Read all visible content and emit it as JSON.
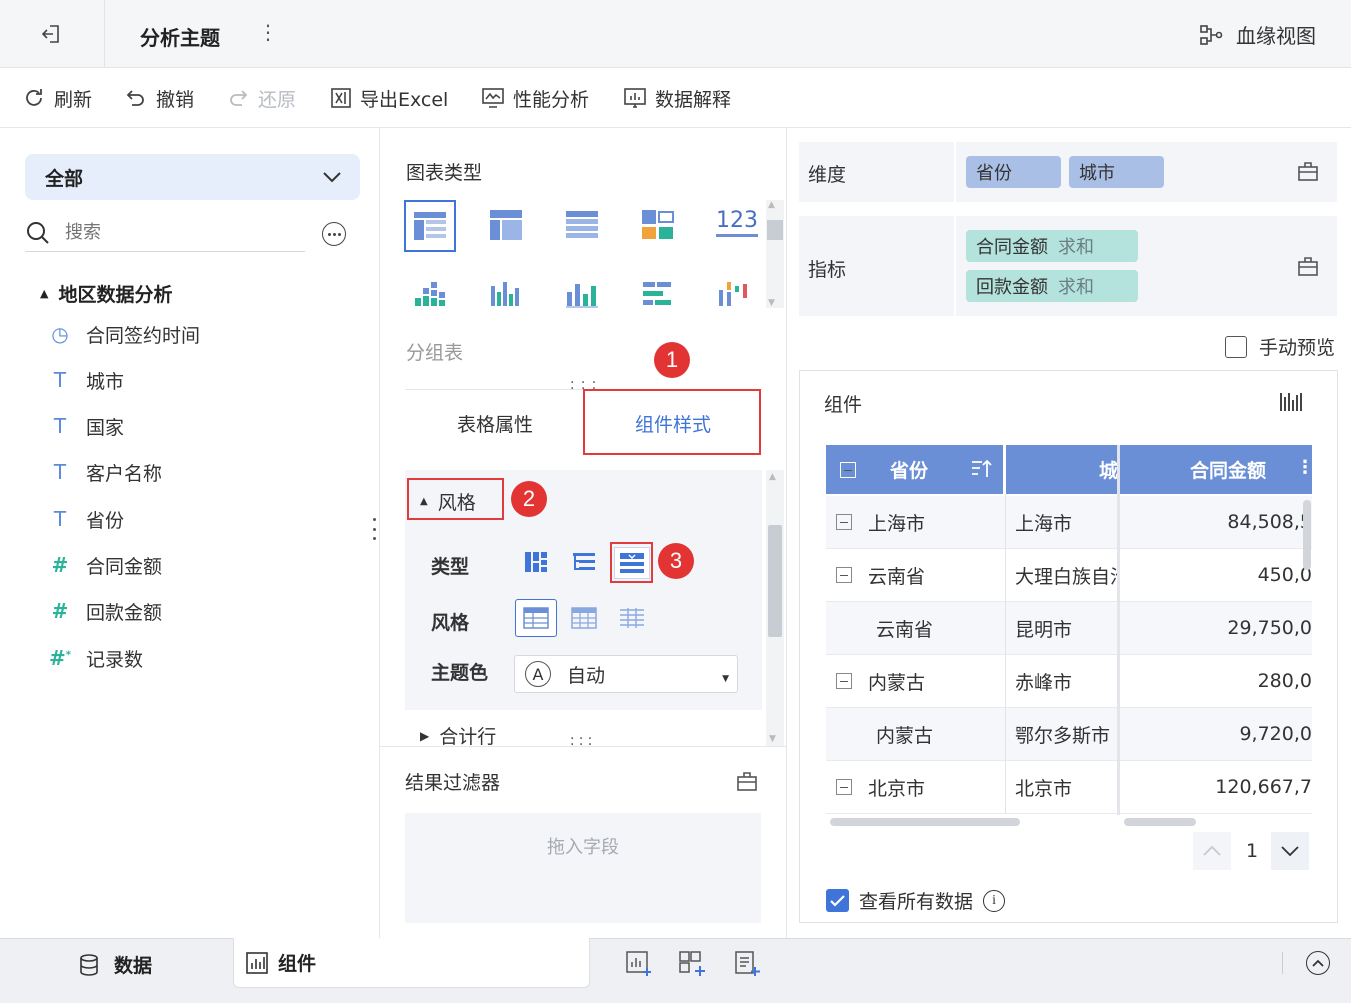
{
  "app": {
    "title": "分析主题",
    "more": "⋮",
    "lineage": "血缘视图"
  },
  "toolbar": {
    "refresh": "刷新",
    "undo": "撤销",
    "redo": "还原",
    "export": "导出Excel",
    "perf": "性能分析",
    "explain": "数据解释"
  },
  "left": {
    "scope": "全部",
    "search_placeholder": "搜索",
    "group": "地区数据分析",
    "fields": [
      {
        "label": "合同签约时间",
        "icon": "clock-icon"
      },
      {
        "label": "城市",
        "icon": "text-icon"
      },
      {
        "label": "国家",
        "icon": "text-icon"
      },
      {
        "label": "客户名称",
        "icon": "text-icon"
      },
      {
        "label": "省份",
        "icon": "text-icon"
      },
      {
        "label": "合同金额",
        "icon": "number-icon"
      },
      {
        "label": "回款金额",
        "icon": "number-icon"
      },
      {
        "label": "记录数",
        "icon": "calc-number-icon"
      }
    ]
  },
  "mid": {
    "chart_type_title": "图表类型",
    "chart_123": "123",
    "selected_chart": "分组表",
    "tabs": [
      "表格属性",
      "组件样式"
    ],
    "style_section": "风格",
    "type_label": "类型",
    "style_label": "风格",
    "theme_label": "主题色",
    "theme_icon_text": "A",
    "theme_value": "自动",
    "total_row": "合计行",
    "filter_title": "结果过滤器",
    "filter_drop": "拖入字段"
  },
  "right": {
    "dimension_label": "维度",
    "dimensions": [
      "省份",
      "城市"
    ],
    "metric_label": "指标",
    "metrics": [
      {
        "name": "合同金额",
        "agg": "求和"
      },
      {
        "name": "回款金额",
        "agg": "求和"
      }
    ],
    "manual_preview": "手动预览",
    "component_title": "组件",
    "table": {
      "headers": [
        "省份",
        "城",
        "合同金额"
      ],
      "rows": [
        {
          "province": "上海市",
          "city": "上海市",
          "amount": "84,508,5",
          "collapse": true
        },
        {
          "province": "云南省",
          "city": "大理白族自治",
          "amount": "450,0",
          "collapse": true
        },
        {
          "province": "云南省",
          "city": "昆明市",
          "amount": "29,750,0",
          "collapse": false
        },
        {
          "province": "内蒙古",
          "city": "赤峰市",
          "amount": "280,0",
          "collapse": true
        },
        {
          "province": "内蒙古",
          "city": "鄂尔多斯市",
          "amount": "9,720,0",
          "collapse": false
        },
        {
          "province": "北京市",
          "city": "北京市",
          "amount": "120,667,7",
          "collapse": true
        }
      ]
    },
    "page": "1",
    "view_all": "查看所有数据"
  },
  "badges": [
    "1",
    "2",
    "3"
  ],
  "bottom": {
    "data_tab": "数据",
    "component_tab": "组件"
  },
  "colors": {
    "accent": "#3f74d8",
    "header": "#6b8fd6",
    "dimension_pill": "#a9bfe6",
    "metric_pill": "#b3e3dc",
    "annotation": "#e23b3b"
  }
}
